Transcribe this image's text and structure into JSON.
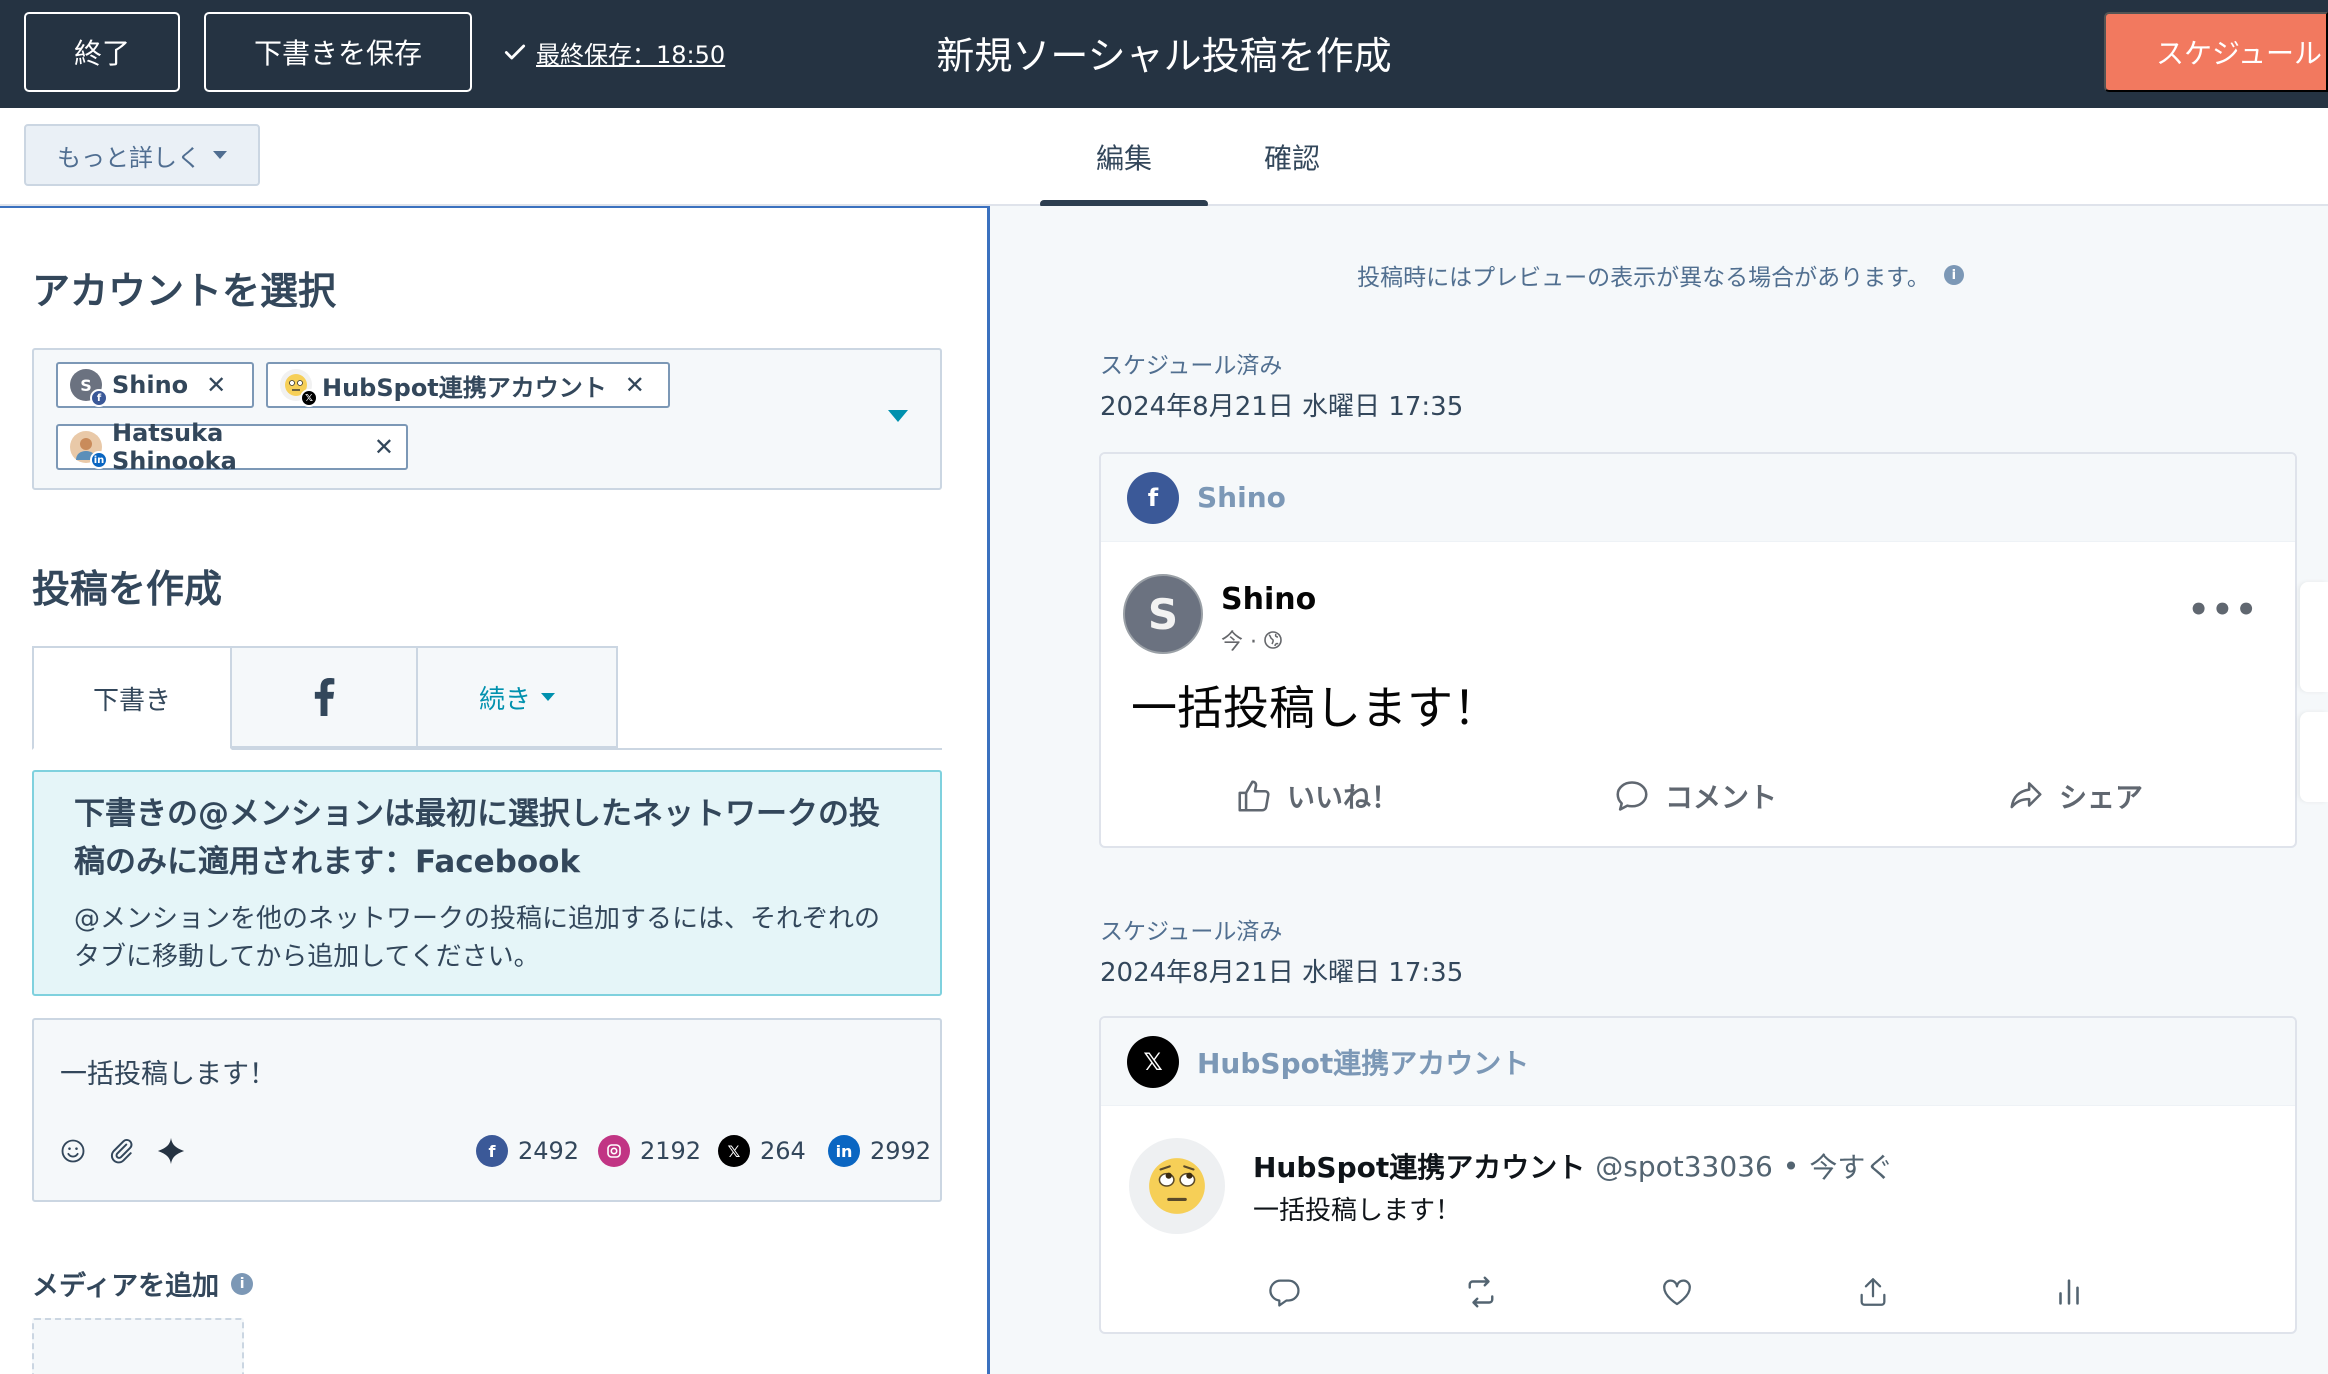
{
  "header": {
    "exit_label": "終了",
    "save_draft_label": "下書きを保存",
    "last_saved": "最終保存：18:50",
    "title": "新規ソーシャル投稿を作成",
    "schedule_label": "スケジュール"
  },
  "subbar": {
    "more_label": "もっと詳しく",
    "tabs": [
      {
        "label": "編集",
        "active": true
      },
      {
        "label": "確認",
        "active": false
      }
    ]
  },
  "accounts": {
    "heading": "アカウントを選択",
    "selected": [
      {
        "name": "Shino",
        "network": "facebook",
        "avatar_letter": "S"
      },
      {
        "name": "HubSpot連携アカウント",
        "network": "x"
      },
      {
        "name": "Hatsuka Shinooka",
        "network": "linkedin"
      }
    ]
  },
  "compose": {
    "heading": "投稿を作成",
    "tabs": [
      {
        "label": "下書き",
        "active": true
      },
      {
        "label": "facebook-icon",
        "active": false
      },
      {
        "label": "続き",
        "active": false
      }
    ],
    "alert": {
      "title": "下書きの@メンションは最初に選択したネットワークの投稿のみに適用されます：Facebook",
      "body": "@メンションを他のネットワークの投稿に追加するには、それぞれのタブに移動してから追加してください。"
    },
    "editor_text": "一括投稿します！",
    "char_counts": [
      {
        "network": "facebook",
        "count": "2492",
        "color": "#3b5998"
      },
      {
        "network": "instagram",
        "count": "2192",
        "color": "#c13584"
      },
      {
        "network": "x",
        "count": "264",
        "color": "#000000"
      },
      {
        "network": "linkedin",
        "count": "2992",
        "color": "#0a66c2"
      }
    ],
    "media_heading": "メディアを追加"
  },
  "preview": {
    "note": "投稿時にはプレビューの表示が異なる場合があります。",
    "posts": [
      {
        "status": "スケジュール済み",
        "datetime": "2024年8月21日 水曜日 17:35",
        "account": "Shino",
        "author": "Shino",
        "meta": "今 ·",
        "text": "一括投稿します！",
        "actions": [
          "いいね！",
          "コメント",
          "シェア"
        ]
      },
      {
        "status": "スケジュール済み",
        "datetime": "2024年8月21日 水曜日 17:35",
        "account": "HubSpot連携アカウント",
        "author": "HubSpot連携アカウント",
        "handle": "@spot33036",
        "dot": "•",
        "time": "今すぐ",
        "text": "一括投稿します！"
      }
    ]
  },
  "colors": {
    "topbar": "#253342",
    "accent": "#f2795f",
    "facebook": "#3b5998",
    "link": "#0091ae"
  }
}
